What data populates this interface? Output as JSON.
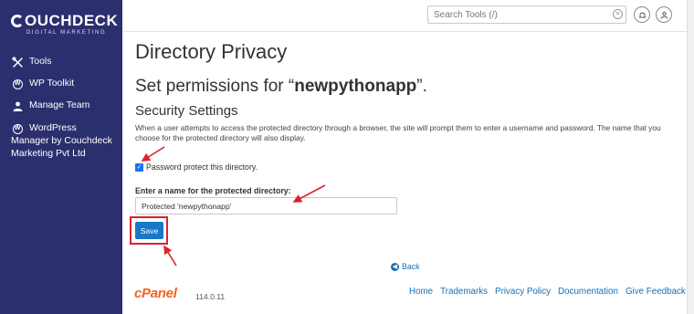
{
  "brand": {
    "name": "OUCHDECK",
    "tagline": "DIGITAL MARKETING"
  },
  "sidebar": {
    "items": [
      {
        "label": "Tools",
        "icon": "tools-icon"
      },
      {
        "label": "WP Toolkit",
        "icon": "wordpress-icon"
      },
      {
        "label": "Manage Team",
        "icon": "team-icon"
      },
      {
        "label_line1": "WordPress",
        "label_rest": "Manager by Couchdeck Marketing Pvt Ltd",
        "icon": "wordpress-icon"
      }
    ]
  },
  "header": {
    "search_placeholder": "Search Tools (/)"
  },
  "main": {
    "page_title": "Directory Privacy",
    "perm_prefix": "Set permissions for “",
    "perm_dir": "newpythonapp",
    "perm_suffix": "”.",
    "section_title": "Security Settings",
    "description": "When a user attempts to access the protected directory through a browser, the site will prompt them to enter a username and password. The name that you choose for the protected directory will also display.",
    "checkbox_label": "Password protect this directory.",
    "checkbox_checked": true,
    "field_label": "Enter a name for the protected directory:",
    "field_value": "Protected 'newpythonapp'",
    "save_label": "Save",
    "back_label": "Back"
  },
  "footer": {
    "cpanel_logo": "cPanel",
    "version": "114.0.11",
    "links": [
      "Home",
      "Trademarks",
      "Privacy Policy",
      "Documentation",
      "Give Feedback"
    ]
  },
  "colors": {
    "sidebar_bg": "#2b2f6e",
    "accent_blue": "#1778c7",
    "annotation_red": "#d9232d",
    "cpanel_orange": "#f26522"
  }
}
